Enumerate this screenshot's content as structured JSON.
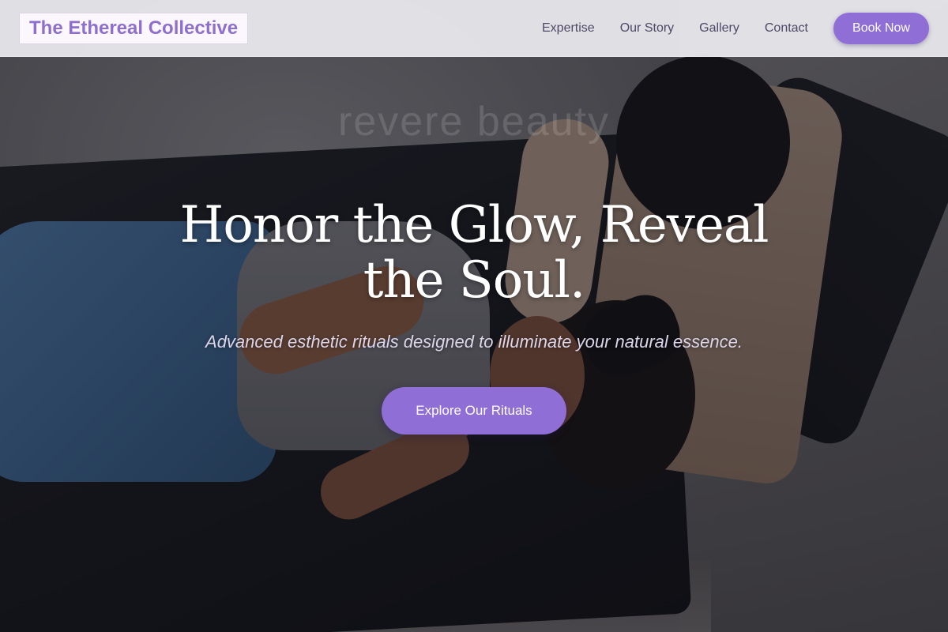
{
  "header": {
    "logo": "The Ethereal Collective",
    "nav": [
      "Expertise",
      "Our Story",
      "Gallery",
      "Contact"
    ],
    "cta": "Book Now"
  },
  "hero": {
    "headline": "Honor the Glow, Reveal the Soul.",
    "watermark": "revere beauty",
    "subtitle": "Advanced esthetic rituals designed to illuminate your natural essence.",
    "cta": "Explore Our Rituals"
  },
  "colors": {
    "accent": "#8f6ed5",
    "logo_text": "#8e6fce",
    "nav_text": "#4f4866",
    "header_bg": "#ececf0"
  }
}
